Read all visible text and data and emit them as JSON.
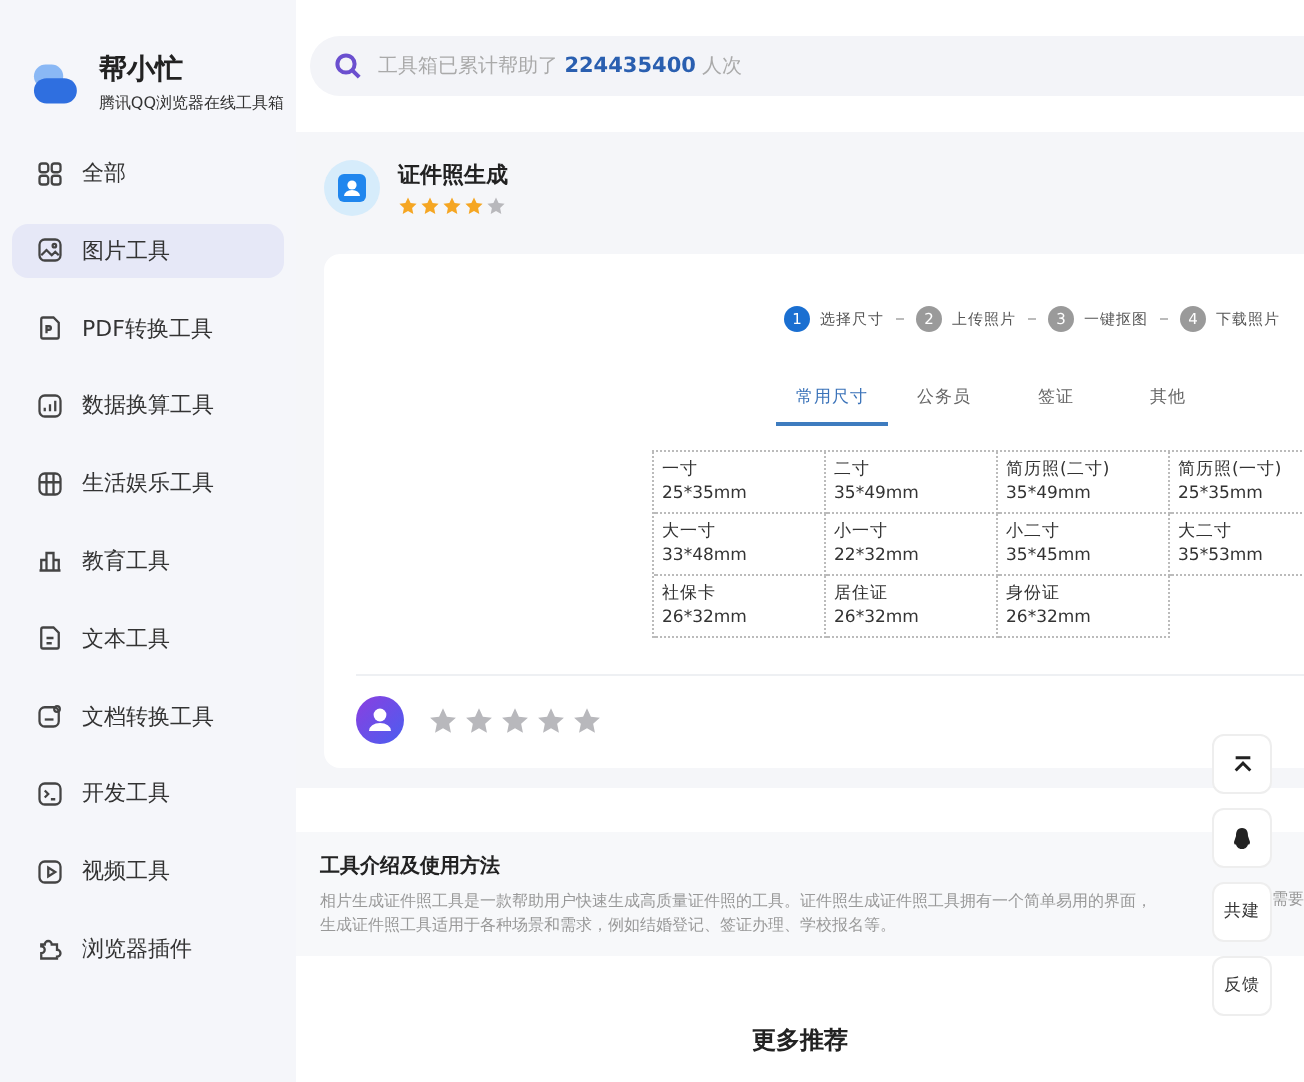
{
  "brand": {
    "name": "帮小忙",
    "subtitle": "腾讯QQ浏览器在线工具箱"
  },
  "sidebar": {
    "items": [
      {
        "kind": "grid",
        "label": "全部",
        "selected": false
      },
      {
        "kind": "image",
        "label": "图片工具",
        "selected": true
      },
      {
        "kind": "pdf",
        "label": "PDF转换工具",
        "selected": false
      },
      {
        "kind": "chart",
        "label": "数据换算工具",
        "selected": false
      },
      {
        "kind": "life",
        "label": "生活娱乐工具",
        "selected": false
      },
      {
        "kind": "edu",
        "label": "教育工具",
        "selected": false
      },
      {
        "kind": "text",
        "label": "文本工具",
        "selected": false
      },
      {
        "kind": "doc",
        "label": "文档转换工具",
        "selected": false
      },
      {
        "kind": "dev",
        "label": "开发工具",
        "selected": false
      },
      {
        "kind": "video",
        "label": "视频工具",
        "selected": false
      },
      {
        "kind": "plugin",
        "label": "浏览器插件",
        "selected": false
      }
    ]
  },
  "search": {
    "prefix": "工具箱已累计帮助了",
    "count": "224435400",
    "suffix": "人次"
  },
  "tool": {
    "title": "证件照生成",
    "stars": 4
  },
  "steps": [
    {
      "number": "1",
      "label": "选择尺寸",
      "selected": true
    },
    {
      "number": "2",
      "label": "上传照片",
      "selected": false
    },
    {
      "number": "3",
      "label": "一键抠图",
      "selected": false
    },
    {
      "number": "4",
      "label": "下载照片",
      "selected": false
    }
  ],
  "tabs": [
    {
      "label": "常用尺寸",
      "selected": true
    },
    {
      "label": "公务员",
      "selected": false
    },
    {
      "label": "签证",
      "selected": false
    },
    {
      "label": "其他",
      "selected": false
    }
  ],
  "sizes": [
    {
      "name": "一寸",
      "size": "25*35mm"
    },
    {
      "name": "二寸",
      "size": "35*49mm"
    },
    {
      "name": "简历照(二寸)",
      "size": "35*49mm"
    },
    {
      "name": "简历照(一寸)",
      "size": "25*35mm"
    },
    {
      "name": "大一寸",
      "size": "33*48mm"
    },
    {
      "name": "小一寸",
      "size": "22*32mm"
    },
    {
      "name": "小二寸",
      "size": "35*45mm"
    },
    {
      "name": "大二寸",
      "size": "35*53mm"
    },
    {
      "name": "社保卡",
      "size": "26*32mm"
    },
    {
      "name": "居住证",
      "size": "26*32mm"
    },
    {
      "name": "身份证",
      "size": "26*32mm"
    }
  ],
  "rating": {
    "stars": 0
  },
  "intro": {
    "title": "工具介绍及使用方法",
    "lines": [
      "相片生成证件照工具是一款帮助用户快速生成高质量证件照的工具。证件照生成证件照工具拥有一个简单易用的界面，",
      "生成证件照工具适用于各种场景和需求，例如结婚登记、签证办理、学校报名等。"
    ],
    "cut_fragment": "需要"
  },
  "float_buttons": [
    {
      "kind": "top"
    },
    {
      "kind": "qq"
    },
    {
      "kind": "text",
      "label": "共建"
    },
    {
      "kind": "text",
      "label": "反馈"
    }
  ],
  "more": {
    "title": "更多推荐"
  }
}
